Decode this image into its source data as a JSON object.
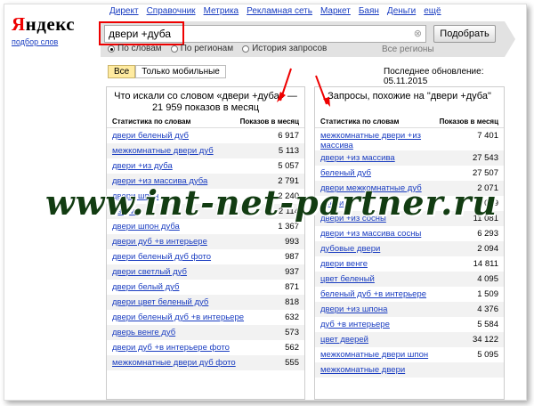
{
  "logo": {
    "text_red": "Я",
    "text_rest": "ндекс",
    "sub": "подбор слов"
  },
  "topnav": [
    "Директ",
    "Справочник",
    "Метрика",
    "Рекламная сеть",
    "Маркет",
    "Баян",
    "Деньги",
    "ещё"
  ],
  "search": {
    "value": "двери +дуба",
    "button": "Подобрать"
  },
  "radios": [
    {
      "label": "По словам",
      "selected": true
    },
    {
      "label": "По регионам",
      "selected": false
    },
    {
      "label": "История запросов",
      "selected": false
    }
  ],
  "regions_label": "Все регионы",
  "tabs": [
    "Все",
    "Только мобильные"
  ],
  "updated": "Последнее обновление: 05.11.2015",
  "left": {
    "title": "Что искали со словом «двери +дуба» — 21 959 показов в месяц",
    "col1": "Статистика по словам",
    "col2": "Показов в месяц",
    "rows": [
      {
        "q": "двери беленый дуб",
        "n": "6 917"
      },
      {
        "q": "межкомнатные двери дуб",
        "n": "5 113"
      },
      {
        "q": "двери +из дуба",
        "n": "5 057"
      },
      {
        "q": "двери +из массива дуба",
        "n": "2 791"
      },
      {
        "q": "двери шпон",
        "n": "2 240"
      },
      {
        "q": "двери",
        "n": "2 114"
      },
      {
        "q": "двери шпон дуба",
        "n": "1 367"
      },
      {
        "q": "двери дуб +в интерьере",
        "n": "993"
      },
      {
        "q": "двери беленый дуб фото",
        "n": "987"
      },
      {
        "q": "двери светлый дуб",
        "n": "937"
      },
      {
        "q": "двери белый дуб",
        "n": "871"
      },
      {
        "q": "двери цвет беленый дуб",
        "n": "818"
      },
      {
        "q": "двери беленый дуб +в интерьере",
        "n": "632"
      },
      {
        "q": "дверь венге дуб",
        "n": "573"
      },
      {
        "q": "двери дуб +в интерьере фото",
        "n": "562"
      },
      {
        "q": "межкомнатные двери дуб фото",
        "n": "555"
      }
    ]
  },
  "right": {
    "title": "Запросы, похожие на \"двери +дуба\"",
    "col1": "Статистика по словам",
    "col2": "Показов в месяц",
    "rows": [
      {
        "q": "межкомнатные двери +из массива",
        "n": "7 401"
      },
      {
        "q": "двери +из массива",
        "n": "27 543"
      },
      {
        "q": "беленый дуб",
        "n": "27 507"
      },
      {
        "q": "двери межкомнатные дуб",
        "n": "2 071"
      },
      {
        "q": "двери",
        "n": "2 049"
      },
      {
        "q": "двери +из сосны",
        "n": "11 081"
      },
      {
        "q": "двери +из массива сосны",
        "n": "6 293"
      },
      {
        "q": "дубовые двери",
        "n": "2 094"
      },
      {
        "q": "двери венге",
        "n": "14 811"
      },
      {
        "q": "цвет беленый",
        "n": "4 095"
      },
      {
        "q": "беленый дуб +в интерьере",
        "n": "1 509"
      },
      {
        "q": "двери +из шпона",
        "n": "4 376"
      },
      {
        "q": "дуб +в интерьере",
        "n": "5 584"
      },
      {
        "q": "цвет дверей",
        "n": "34 122"
      },
      {
        "q": "межкомнатные двери шпон",
        "n": "5 095"
      },
      {
        "q": "межкомнатные двери",
        "n": ""
      }
    ]
  },
  "watermark": "www.int-net-partner.ru"
}
